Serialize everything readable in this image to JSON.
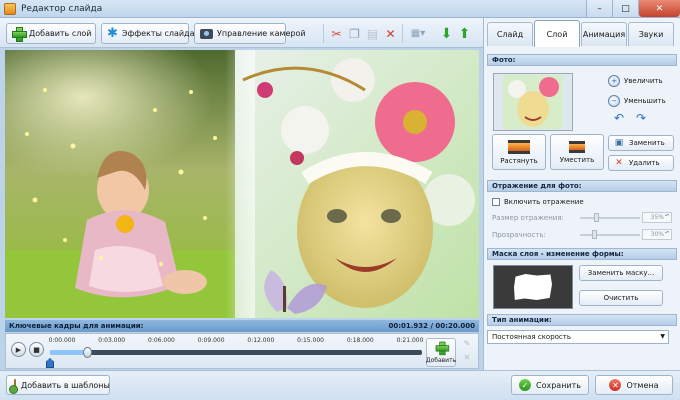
{
  "window": {
    "title": "Редактор слайда"
  },
  "toolbar": {
    "add_layer": "Добавить слой",
    "effects": "Эффекты слайда",
    "camera": "Управление камерой"
  },
  "canvas": {
    "icons": [
      "scissors-icon",
      "copy-icon",
      "paste-icon",
      "delete-icon",
      "grid-icon",
      "move-down-icon",
      "move-up-icon"
    ]
  },
  "timeline": {
    "header": "Ключевые кадры для анимации:",
    "time_display": "00:01.932 / 00:20.000",
    "ticks": [
      "0:00.000",
      "0:03.000",
      "0:06.000",
      "0:09.000",
      "0:12.000",
      "0:15.000",
      "0:18.000",
      "0:21.000"
    ],
    "progress": 0.1,
    "add_label": "Добавить"
  },
  "tabs": [
    {
      "label": "Слайд",
      "active": false
    },
    {
      "label": "Слой",
      "active": true
    },
    {
      "label": "Анимация",
      "active": false
    },
    {
      "label": "Звуки",
      "active": false
    }
  ],
  "panel": {
    "photo_header": "Фото:",
    "zoom_in": "Увеличить",
    "zoom_out": "Уменьшить",
    "stretch": "Растянуть",
    "fit": "Уместить",
    "replace": "Заменить",
    "delete": "Удалить",
    "reflection_header": "Отражение для фото:",
    "enable_reflection": "Включить отражение",
    "reflection_size_label": "Размер отражения:",
    "reflection_size_value": "35%",
    "transparency_label": "Прозрачность:",
    "transparency_value": "30%",
    "mask_header": "Маска слоя - изменение формы:",
    "replace_mask": "Заменить маску...",
    "clear": "Очистить",
    "animation_type_header": "Тип анимации:",
    "animation_type_value": "Постоянная скорость"
  },
  "bottom": {
    "add_to_templates": "Добавить в шаблоны",
    "save": "Сохранить",
    "cancel": "Отмена"
  },
  "colors": {
    "accent": "#6b9bcc",
    "close_button": "#c4432b",
    "save_icon": "#2b9320",
    "cancel_icon": "#c8321e"
  }
}
